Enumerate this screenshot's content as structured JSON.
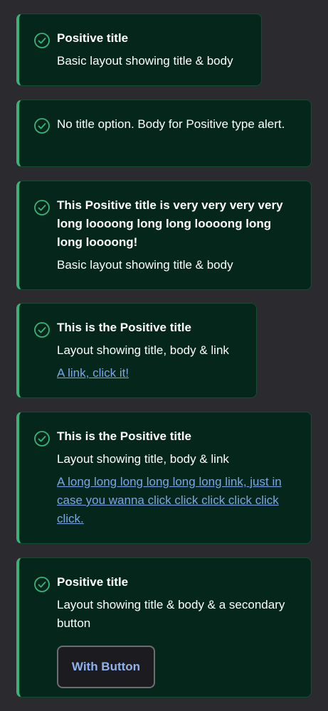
{
  "alerts": [
    {
      "title": "Positive title",
      "body": "Basic layout showing title & body"
    },
    {
      "body": "No title option. Body for Positive type alert."
    },
    {
      "title": "This Positive title is very very very very long loooong long long loooong long long loooong!",
      "body": "Basic layout showing title & body"
    },
    {
      "title": "This is the Positive title",
      "body": "Layout showing title, body & link",
      "link": "A link, click it!"
    },
    {
      "title": "This is the Positive title",
      "body": "Layout showing title, body & link",
      "link": "A long long long long long long link, just in case you wanna click click click click click click."
    },
    {
      "title": "Positive title",
      "body": "Layout showing title & body & a secondary button",
      "button": "With Button"
    }
  ],
  "icon": "check-circle-icon",
  "colors": {
    "background": "#2b2a2e",
    "alert_bg": "#05261a",
    "accent": "#3ab37a",
    "link": "#7aa7e6"
  }
}
